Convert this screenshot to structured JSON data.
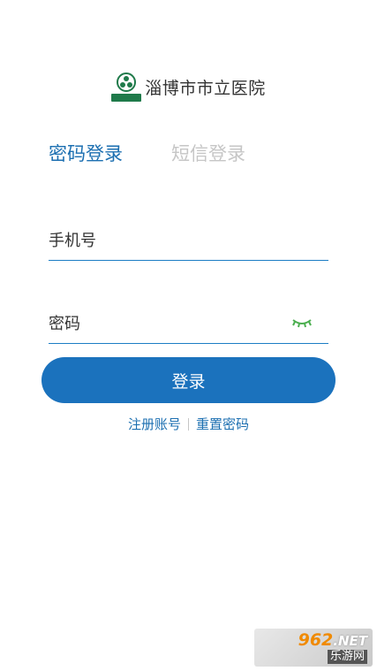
{
  "header": {
    "hospital_name": "淄博市市立医院",
    "logo_icon": "hospital-logo-icon"
  },
  "tabs": [
    {
      "label": "密码登录",
      "active": true
    },
    {
      "label": "短信登录",
      "active": false
    }
  ],
  "form": {
    "phone_placeholder": "手机号",
    "phone_value": "",
    "password_placeholder": "密码",
    "password_value": "",
    "eye_icon": "eye-closed-icon"
  },
  "login_button": {
    "label": "登录"
  },
  "links": {
    "register": "注册账号",
    "reset_password": "重置密码"
  },
  "watermark": {
    "top": "962",
    "top_suffix": ".NET",
    "bottom": "乐游网"
  },
  "colors": {
    "primary": "#1b72bd",
    "inactive_tab": "#c6c6c6",
    "eye": "#4caf50",
    "logo": "#1f7a4a"
  }
}
